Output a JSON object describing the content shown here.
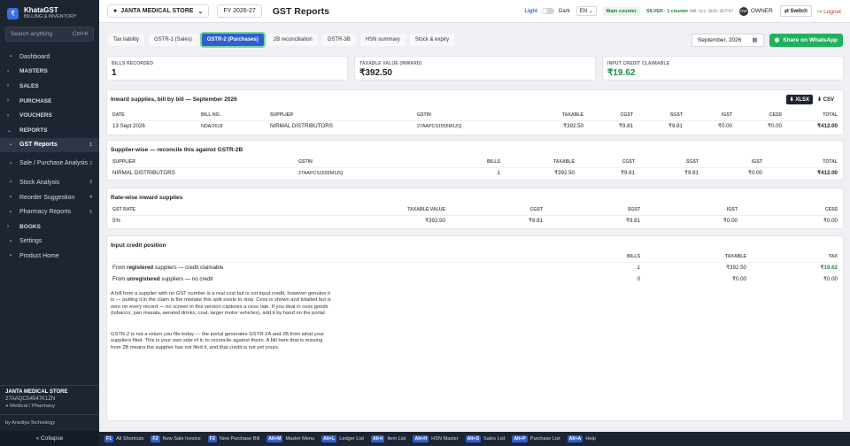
{
  "brand": {
    "name": "KhataGST",
    "tagline": "BILLING & INVENTORY",
    "logo": "₹"
  },
  "search": {
    "placeholder": "Search anything",
    "hint": "Ctrl+K"
  },
  "nav": [
    {
      "label": "Dashboard",
      "icon": "▪",
      "type": "item"
    },
    {
      "label": "MASTERS",
      "type": "section"
    },
    {
      "label": "SALES",
      "type": "section"
    },
    {
      "label": "PURCHASE",
      "type": "section"
    },
    {
      "label": "VOUCHERS",
      "type": "section"
    },
    {
      "label": "REPORTS",
      "type": "section-open"
    },
    {
      "label": "GST Reports",
      "icon": "▪",
      "count": "1",
      "type": "active"
    },
    {
      "label": "Sale / Purchase Analysis",
      "icon": "▪",
      "count": "2",
      "type": "two"
    },
    {
      "label": "Stock Analysis",
      "icon": "▪",
      "count": "3",
      "type": "item"
    },
    {
      "label": "Reorder Suggestion",
      "icon": "▪",
      "count": "4",
      "type": "item"
    },
    {
      "label": "Pharmacy Reports",
      "icon": "▪",
      "count": "5",
      "type": "item"
    },
    {
      "label": "BOOKS",
      "type": "section"
    },
    {
      "label": "Settings",
      "icon": "▪",
      "type": "item"
    },
    {
      "label": "Product Home",
      "icon": "▪",
      "type": "item"
    }
  ],
  "store": {
    "name": "JANTA MEDICAL STORE",
    "gstin": "27AAQCS4547K1ZN",
    "category": "Medical / Pharmacy"
  },
  "by": "by Anediya Technology",
  "collapse": "« Collapse",
  "topbar": {
    "store": "JANTA MEDICAL STORE",
    "fy": "FY 2026-27",
    "title": "GST Reports",
    "light": "Light",
    "dark": "Dark",
    "lang": "EN",
    "counter": "Main counter",
    "plan": "SILVER · 1 counter",
    "plan_code": "ANR-SLV-2026-4E7F97",
    "avatar": "OW",
    "owner": "OWNER",
    "switch": "⇄ Switch",
    "logout": "↪ Logout"
  },
  "tabs": [
    "Tax liability",
    "GSTR-1 (Sales)",
    "GSTR-2 (Purchases)",
    "2B reconciliation",
    "GSTR-3B",
    "HSN summary",
    "Stock & expiry"
  ],
  "active_tab": 2,
  "date": "September, 2026",
  "whatsapp": "Share on WhatsApp",
  "stats": [
    {
      "label": "BILLS RECORDED",
      "value": "1"
    },
    {
      "label": "TAXABLE VALUE (INWARD)",
      "value": "₹392.50"
    },
    {
      "label": "INPUT CREDIT CLAIMABLE",
      "value": "₹19.62"
    }
  ],
  "inward": {
    "title": "Inward supplies, bill by bill — September 2026",
    "xlsx": "⬇ XLSX",
    "csv": "⬇ CSV",
    "headers": [
      "DATE",
      "BILL NO.",
      "SUPPLIER",
      "GSTIN",
      "TAXABLE",
      "CGST",
      "SGST",
      "IGST",
      "CESS",
      "TOTAL"
    ],
    "row": [
      "13 Sept 2026",
      "NDA/2618",
      "NIRMAL DISTRIBUTORS",
      "27AAPCS1555M1ZQ",
      "₹392.50",
      "₹9.81",
      "₹9.81",
      "₹0.00",
      "₹0.00",
      "₹412.00"
    ]
  },
  "supplier": {
    "title": "Supplier-wise — reconcile this against GSTR-2B",
    "headers": [
      "SUPPLIER",
      "GSTIN",
      "BILLS",
      "TAXABLE",
      "CGST",
      "SGST",
      "IGST",
      "TOTAL"
    ],
    "row": [
      "NIRMAL DISTRIBUTORS",
      "27AAPCS1555M1ZQ",
      "1",
      "₹392.50",
      "₹9.81",
      "₹9.81",
      "₹0.00",
      "₹412.00"
    ]
  },
  "rate": {
    "title": "Rate-wise inward supplies",
    "headers": [
      "GST RATE",
      "TAXABLE VALUE",
      "CGST",
      "SGST",
      "IGST",
      "CESS"
    ],
    "row": [
      "5%",
      "₹392.50",
      "₹9.81",
      "₹9.81",
      "₹0.00",
      "₹0.00"
    ]
  },
  "credit": {
    "title": "Input credit position",
    "headers": [
      "",
      "BILLS",
      "TAXABLE",
      "TAX"
    ],
    "rows": [
      {
        "pre": "From ",
        "bold": "registered",
        "post": " suppliers — credit claimable",
        "bills": "1",
        "taxable": "₹392.50",
        "tax": "₹19.62"
      },
      {
        "pre": "From ",
        "bold": "unregistered",
        "post": " suppliers — no credit",
        "bills": "0",
        "taxable": "₹0.00",
        "tax": "₹0.00"
      }
    ],
    "note1": "A bill from a supplier with no GST number is a real cost but is not input credit, however genuine it is — putting it in the claim is the mistake this split exists to stop. Cess is shown and totalled but is zero on every record — no screen in this version captures a cess rate. If you deal in cess goods (tobacco, pan masala, aerated drinks, coal, larger motor vehicles), add it by hand on the portal.",
    "note2": "GSTR-2 is not a return you file today — the portal generates GSTR-2A and 2B from what your suppliers filed. This is your own side of it, to reconcile against theirs. A bill here that is missing from 2B means the supplier has not filed it, and that credit is not yet yours."
  },
  "footer": [
    {
      "key": "F1",
      "label": "All Shortcuts"
    },
    {
      "key": "F2",
      "label": "New Sale Invoice"
    },
    {
      "key": "F3",
      "label": "New Purchase Bill"
    },
    {
      "key": "Alt+M",
      "label": "Master Menu"
    },
    {
      "key": "Alt+L",
      "label": "Ledger List"
    },
    {
      "key": "Alt+I",
      "label": "Item List"
    },
    {
      "key": "Alt+H",
      "label": "HSN Master"
    },
    {
      "key": "Alt+S",
      "label": "Sales List"
    },
    {
      "key": "Alt+P",
      "label": "Purchase List"
    },
    {
      "key": "Alt+A",
      "label": "Help"
    }
  ]
}
